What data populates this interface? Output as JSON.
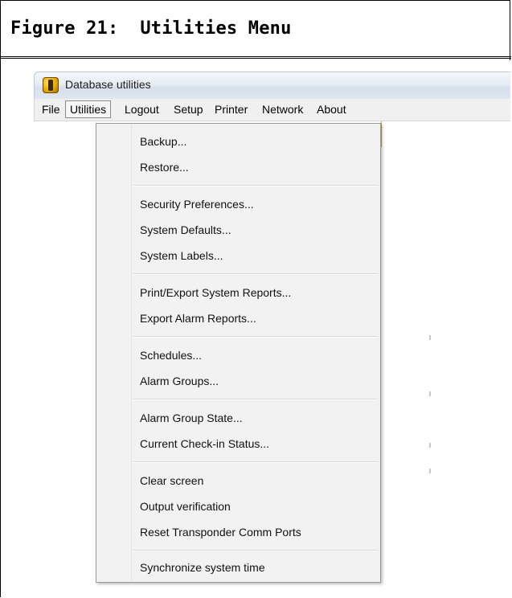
{
  "figure": {
    "title": "Figure 21:  Utilities Menu"
  },
  "window": {
    "title": "Database utilities",
    "icon": "database-app-icon"
  },
  "menubar": {
    "items": [
      {
        "label": "File"
      },
      {
        "label": "Utilities",
        "active": true
      },
      {
        "label": "Logout"
      },
      {
        "label": "Setup"
      },
      {
        "label": "Printer"
      },
      {
        "label": "Network"
      },
      {
        "label": "About"
      }
    ]
  },
  "utilities_menu": {
    "items": [
      "Backup...",
      "Restore...",
      "Security Preferences...",
      "System Defaults...",
      "System Labels...",
      "Print/Export System Reports...",
      "Export Alarm Reports...",
      "Schedules...",
      "Alarm Groups...",
      "Alarm Group State...",
      "Current Check-in Status...",
      "Clear screen",
      "Output verification",
      "Reset Transponder Comm Ports",
      "Synchronize system time"
    ]
  },
  "colors": {
    "menu_background": "#f2f2f2",
    "active_menu_border": "#8a8a8a",
    "frame": "#000000"
  }
}
